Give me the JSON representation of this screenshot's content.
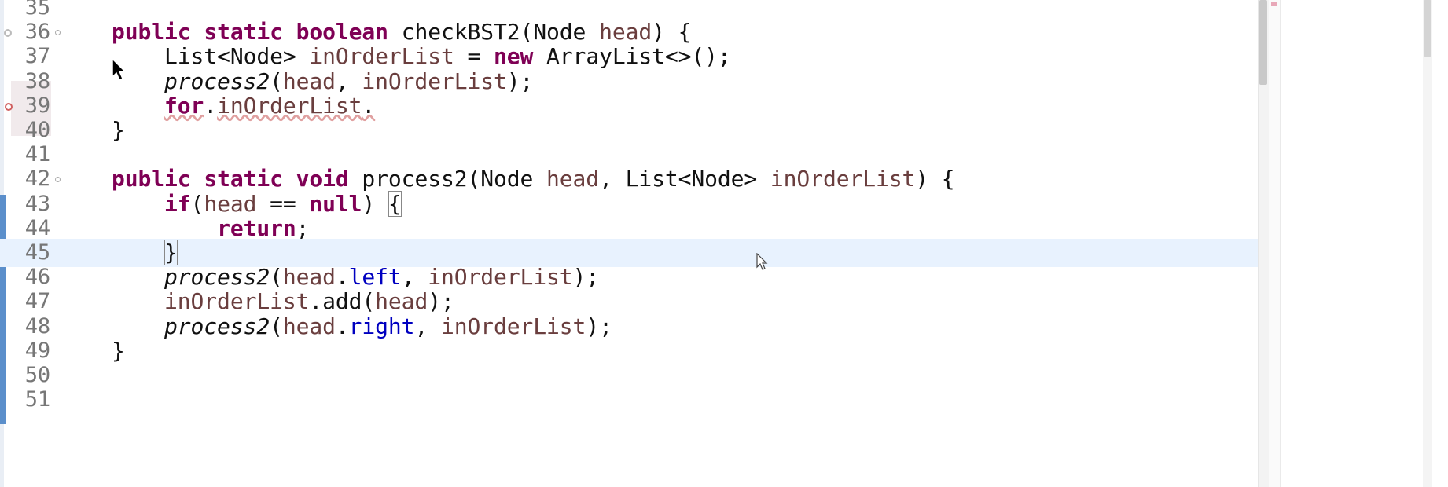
{
  "editor": {
    "lines": [
      {
        "no": "35",
        "segments": []
      },
      {
        "no": "36",
        "fold": true,
        "override_marker": true,
        "segments": [
          {
            "t": "public",
            "c": "kw"
          },
          {
            "t": " "
          },
          {
            "t": "static",
            "c": "kw"
          },
          {
            "t": " "
          },
          {
            "t": "boolean",
            "c": "kw"
          },
          {
            "t": " checkBST2(Node "
          },
          {
            "t": "head",
            "c": "var"
          },
          {
            "t": ") {"
          }
        ]
      },
      {
        "no": "37",
        "segments": [
          {
            "t": "    List<Node> "
          },
          {
            "t": "inOrderList",
            "c": "var"
          },
          {
            "t": " = "
          },
          {
            "t": "new",
            "c": "kw"
          },
          {
            "t": " ArrayList<>();"
          }
        ]
      },
      {
        "no": "38",
        "segments": [
          {
            "t": "    "
          },
          {
            "t": "process2",
            "c": "mth"
          },
          {
            "t": "("
          },
          {
            "t": "head",
            "c": "var"
          },
          {
            "t": ", "
          },
          {
            "t": "inOrderList",
            "c": "var"
          },
          {
            "t": ");"
          }
        ]
      },
      {
        "no": "39",
        "error_marker": true,
        "segments": [
          {
            "t": "    "
          },
          {
            "t": "for",
            "c": "kw err"
          },
          {
            "t": "."
          },
          {
            "t": "inOrderList",
            "c": "var err"
          },
          {
            "t": ".",
            "c": "err"
          }
        ]
      },
      {
        "no": "40",
        "segments": [
          {
            "t": "}"
          }
        ]
      },
      {
        "no": "41",
        "segments": []
      },
      {
        "no": "42",
        "fold": true,
        "segments": [
          {
            "t": "public",
            "c": "kw"
          },
          {
            "t": " "
          },
          {
            "t": "static",
            "c": "kw"
          },
          {
            "t": " "
          },
          {
            "t": "void",
            "c": "kw"
          },
          {
            "t": " process2(Node "
          },
          {
            "t": "head",
            "c": "var"
          },
          {
            "t": ", List<Node> "
          },
          {
            "t": "inOrderList",
            "c": "var"
          },
          {
            "t": ") {"
          }
        ]
      },
      {
        "no": "43",
        "segments": [
          {
            "t": "    "
          },
          {
            "t": "if",
            "c": "kw"
          },
          {
            "t": "("
          },
          {
            "t": "head",
            "c": "var"
          },
          {
            "t": " == "
          },
          {
            "t": "null",
            "c": "kw"
          },
          {
            "t": ") "
          },
          {
            "t": "{",
            "c": "bracket"
          }
        ]
      },
      {
        "no": "44",
        "segments": [
          {
            "t": "        "
          },
          {
            "t": "return",
            "c": "kw"
          },
          {
            "t": ";"
          }
        ]
      },
      {
        "no": "45",
        "current": true,
        "segments": [
          {
            "t": "    "
          },
          {
            "t": "}",
            "c": "bracket"
          }
        ]
      },
      {
        "no": "46",
        "segments": [
          {
            "t": "    "
          },
          {
            "t": "process2",
            "c": "mth"
          },
          {
            "t": "("
          },
          {
            "t": "head",
            "c": "var"
          },
          {
            "t": "."
          },
          {
            "t": "left",
            "c": "fld"
          },
          {
            "t": ", "
          },
          {
            "t": "inOrderList",
            "c": "var"
          },
          {
            "t": ");"
          }
        ]
      },
      {
        "no": "47",
        "segments": [
          {
            "t": "    "
          },
          {
            "t": "inOrderList",
            "c": "var"
          },
          {
            "t": ".add("
          },
          {
            "t": "head",
            "c": "var"
          },
          {
            "t": ");"
          }
        ]
      },
      {
        "no": "48",
        "segments": [
          {
            "t": "    "
          },
          {
            "t": "process2",
            "c": "mth"
          },
          {
            "t": "("
          },
          {
            "t": "head",
            "c": "var"
          },
          {
            "t": "."
          },
          {
            "t": "right",
            "c": "fld"
          },
          {
            "t": ", "
          },
          {
            "t": "inOrderList",
            "c": "var"
          },
          {
            "t": ");"
          }
        ]
      },
      {
        "no": "49",
        "segments": [
          {
            "t": "}"
          }
        ]
      },
      {
        "no": "50",
        "segments": []
      },
      {
        "no": "51",
        "segments": []
      }
    ]
  },
  "colors": {
    "keyword": "#7f0055",
    "variable": "#6a3e3e",
    "field": "#0000c0",
    "current_line": "#e8f2fe",
    "change_stripe": "#5b8fcb"
  }
}
